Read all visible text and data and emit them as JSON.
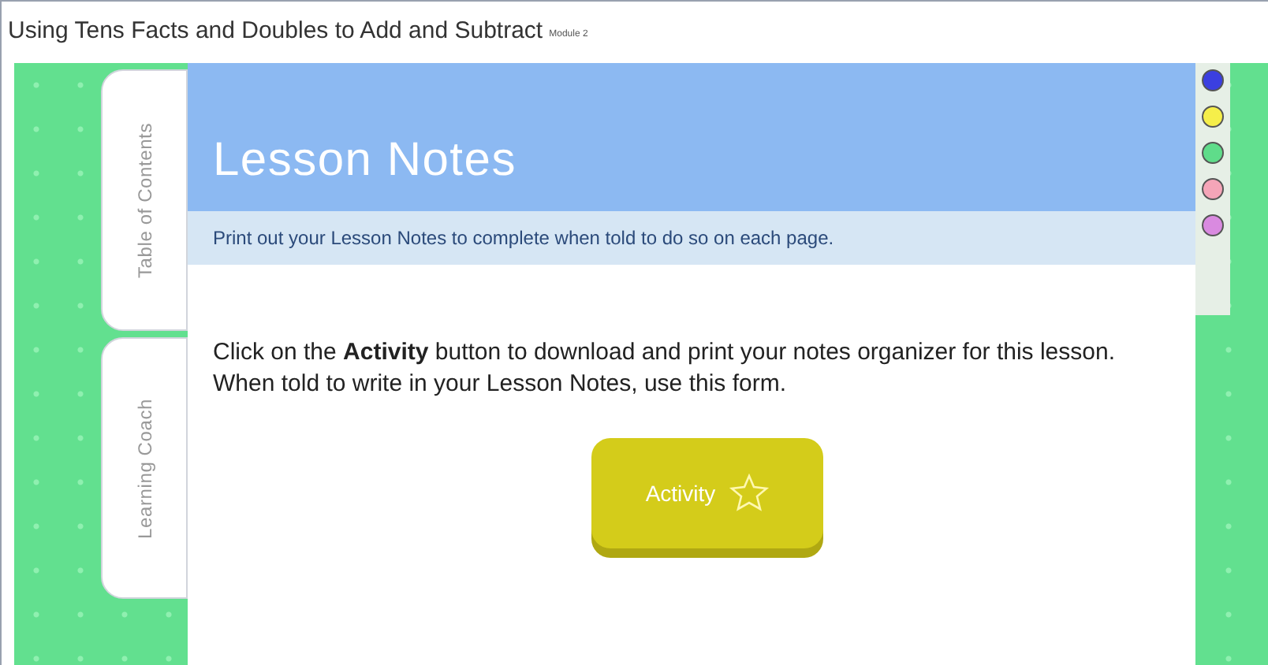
{
  "page_title": {
    "text": "Using Tens Facts and Doubles to Add and Subtract",
    "badge": "Module 2"
  },
  "side_tabs": [
    {
      "label": "Table of Contents",
      "selected": false
    },
    {
      "label": "Learning Coach",
      "selected": false
    }
  ],
  "lesson": {
    "title": "Lesson Notes",
    "subtitle": "Print out your Lesson Notes to complete when told to do so on each page.",
    "body": "Click on the **Activity** button to download and print your notes organizer for this lesson. When told to write in your Lesson Notes, use this form.",
    "button": "Activity"
  },
  "highlighters": [
    {
      "color": "#3b3fe0"
    },
    {
      "color": "#f5ee4a"
    },
    {
      "color": "#5fdc8a"
    },
    {
      "color": "#f5a5b8"
    },
    {
      "color": "#d98ae0"
    }
  ]
}
